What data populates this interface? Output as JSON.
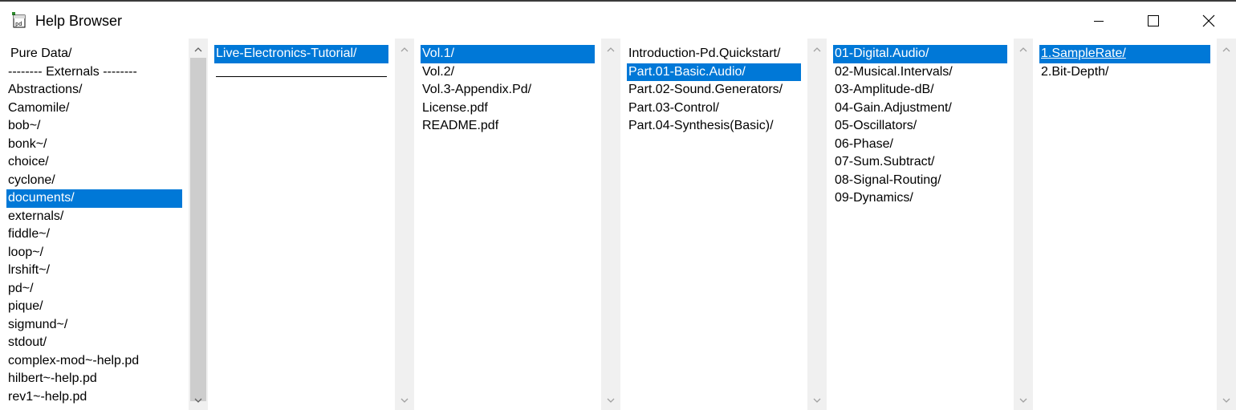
{
  "window": {
    "title": "Help Browser",
    "icon": "pd-app-icon",
    "controls": [
      "minimize-icon",
      "maximize-icon",
      "close-icon"
    ]
  },
  "columns": [
    {
      "items": [
        {
          "label": "Pure Data/"
        },
        {
          "label": "-------- Externals --------"
        },
        {
          "label": "Abstractions/"
        },
        {
          "label": "Camomile/"
        },
        {
          "label": "bob~/"
        },
        {
          "label": "bonk~/"
        },
        {
          "label": "choice/"
        },
        {
          "label": "cyclone/"
        },
        {
          "label": "documents/",
          "selected": true
        },
        {
          "label": "externals/"
        },
        {
          "label": "fiddle~/"
        },
        {
          "label": "loop~/"
        },
        {
          "label": "lrshift~/"
        },
        {
          "label": "pd~/"
        },
        {
          "label": "pique/"
        },
        {
          "label": "sigmund~/"
        },
        {
          "label": "stdout/"
        },
        {
          "label": "complex-mod~-help.pd"
        },
        {
          "label": "hilbert~-help.pd"
        },
        {
          "label": "rev1~-help.pd"
        }
      ],
      "has_thumb": true
    },
    {
      "items": [
        {
          "label": "Live-Electronics-Tutorial/",
          "selected": true
        }
      ],
      "has_thumb": false
    },
    {
      "items": [
        {
          "label": "Vol.1/",
          "selected": true
        },
        {
          "label": "Vol.2/"
        },
        {
          "label": "Vol.3-Appendix.Pd/"
        },
        {
          "label": "License.pdf"
        },
        {
          "label": "README.pdf"
        }
      ],
      "has_thumb": false
    },
    {
      "items": [
        {
          "label": "Introduction-Pd.Quickstart/"
        },
        {
          "label": "Part.01-Basic.Audio/",
          "selected": true
        },
        {
          "label": "Part.02-Sound.Generators/"
        },
        {
          "label": "Part.03-Control/"
        },
        {
          "label": "Part.04-Synthesis(Basic)/"
        }
      ],
      "has_thumb": false
    },
    {
      "items": [
        {
          "label": "01-Digital.Audio/",
          "selected": true
        },
        {
          "label": "02-Musical.Intervals/"
        },
        {
          "label": "03-Amplitude-dB/"
        },
        {
          "label": "04-Gain.Adjustment/"
        },
        {
          "label": "05-Oscillators/"
        },
        {
          "label": "06-Phase/"
        },
        {
          "label": "07-Sum.Subtract/"
        },
        {
          "label": "08-Signal-Routing/"
        },
        {
          "label": "09-Dynamics/"
        }
      ],
      "has_thumb": false
    },
    {
      "items": [
        {
          "label": "1.SampleRate/",
          "selected": true,
          "underlined": true
        },
        {
          "label": "2.Bit-Depth/"
        }
      ],
      "has_thumb": false
    }
  ],
  "colors": {
    "selection": "#0078d7",
    "scrollbar_track": "#f0f0f0",
    "scrollbar_thumb": "#cdcdcd"
  }
}
